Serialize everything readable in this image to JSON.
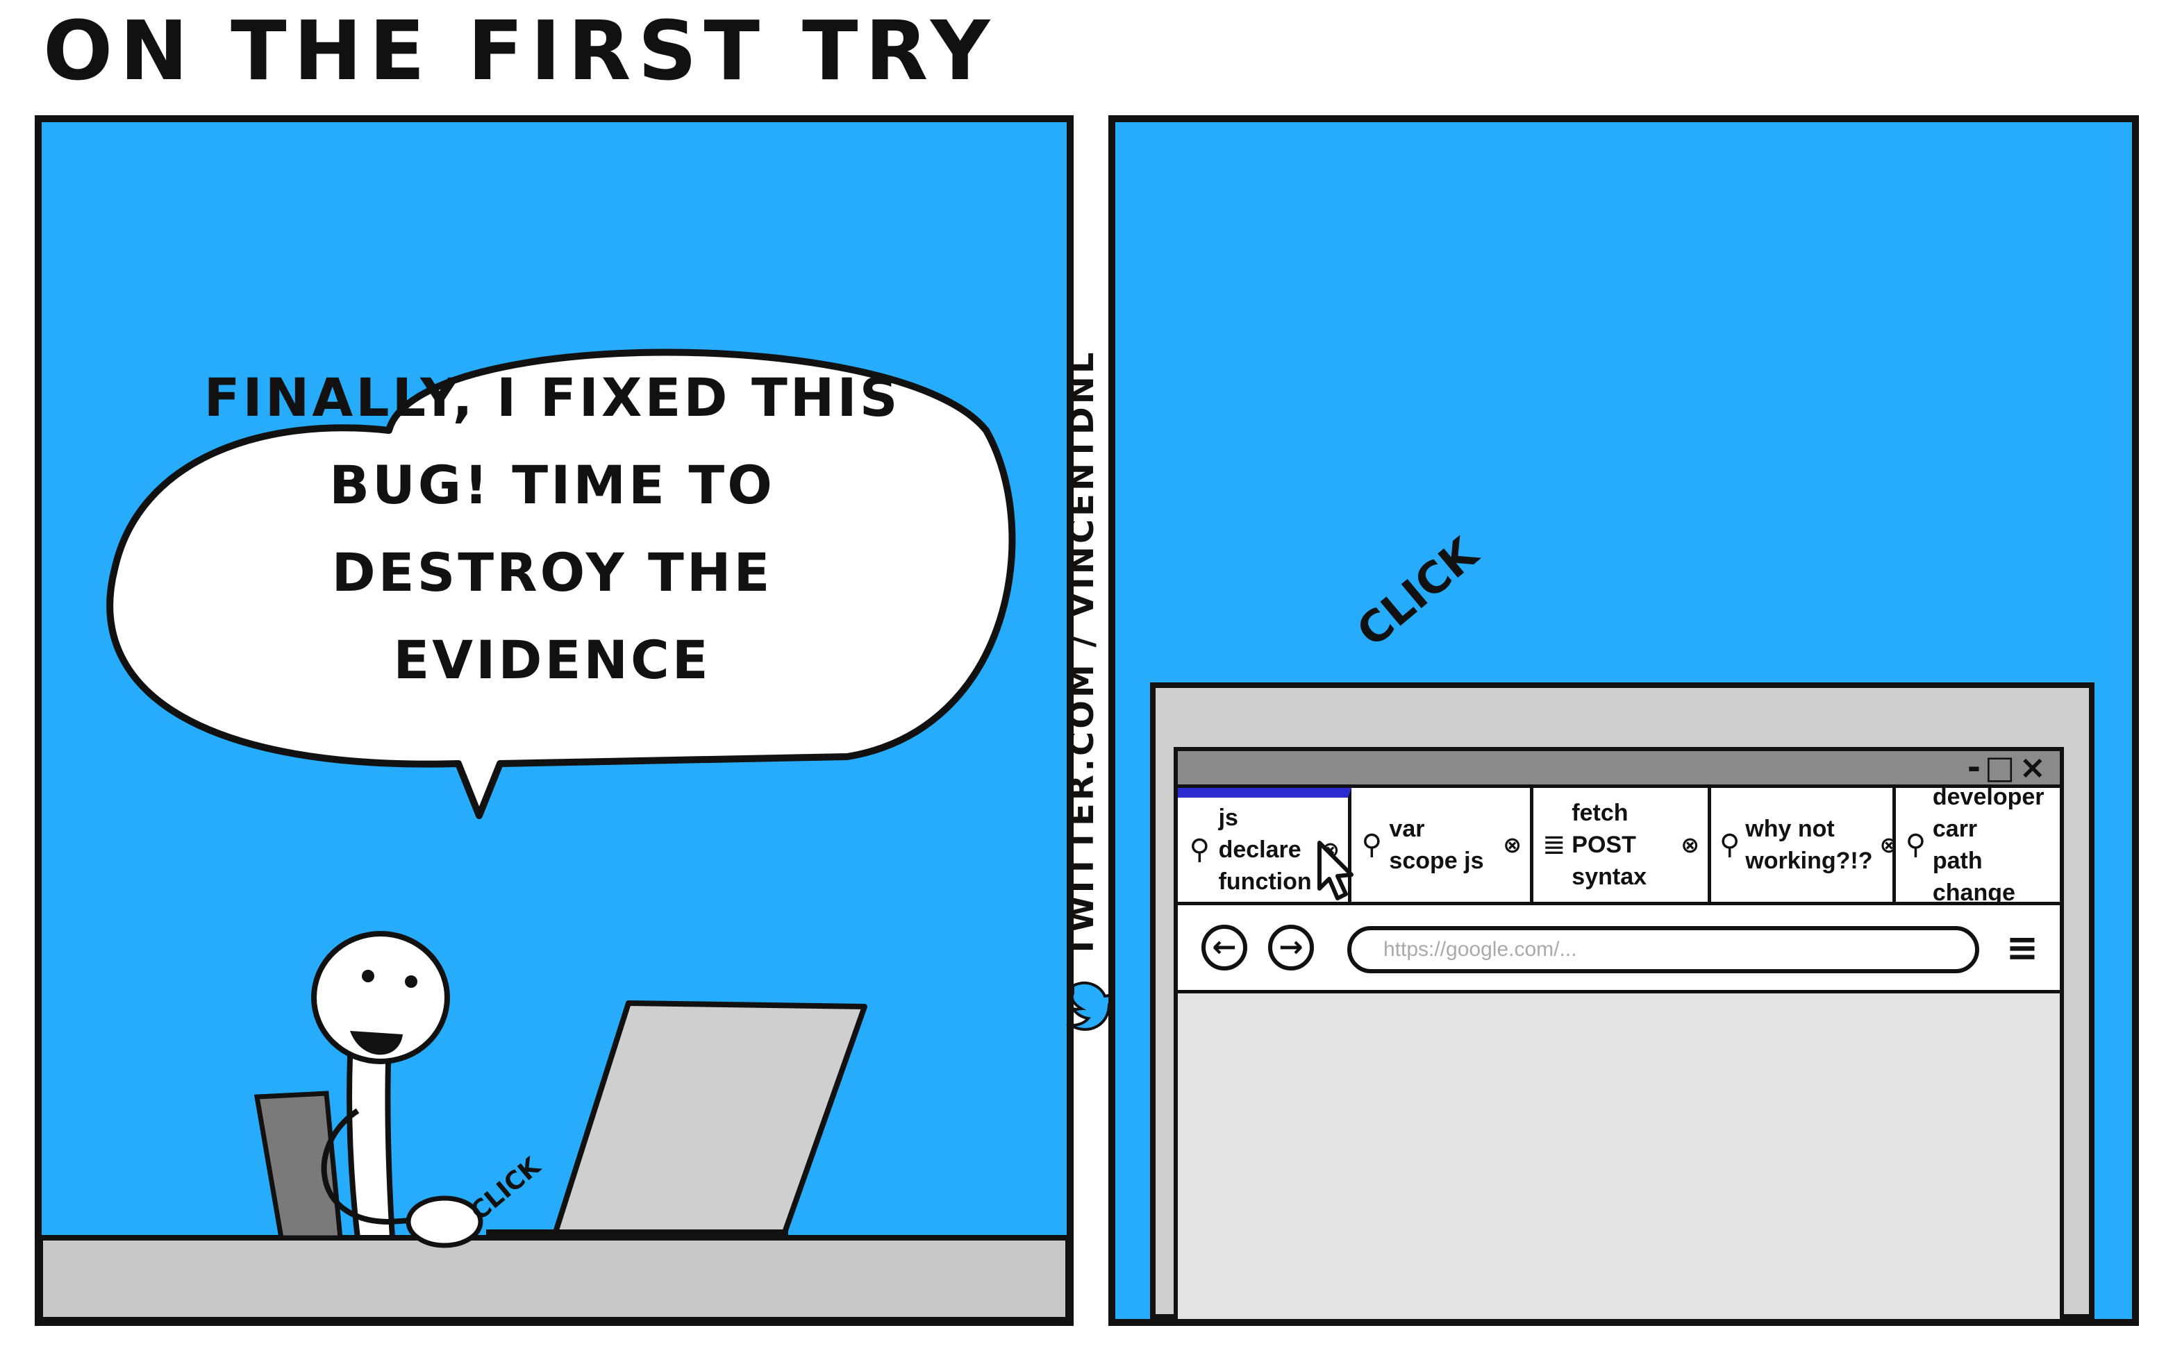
{
  "comic": {
    "title": "ON THE FIRST TRY",
    "credit": "TWITTER.COM / VINCENTDNL"
  },
  "panel_left": {
    "speech": "FINALLY, I FIXED THIS BUG! TIME TO DESTROY THE EVIDENCE",
    "sfx": "CLICK"
  },
  "panel_right": {
    "sfx": "CLICK",
    "browser": {
      "window_controls": "-□×",
      "tabs": [
        {
          "icon": "search-icon",
          "label": "js declare\nfunction",
          "active": true
        },
        {
          "icon": "search-icon",
          "label": "var scope js",
          "active": false
        },
        {
          "icon": "stackoverflow-icon",
          "label": "fetch POST\nsyntax",
          "active": false
        },
        {
          "icon": "search-icon",
          "label": "why not\nworking?!?",
          "active": false
        },
        {
          "icon": "search-icon",
          "label": "developer carr\npath change",
          "active": false
        }
      ],
      "url_placeholder": "https://google.com/...",
      "back_glyph": "←",
      "forward_glyph": "→",
      "menu_glyph": "≡",
      "close_glyph": "⊗"
    }
  },
  "colors": {
    "panel_bg": "#27acfb",
    "ink": "#111111",
    "active_tab": "#2b2bd0"
  }
}
